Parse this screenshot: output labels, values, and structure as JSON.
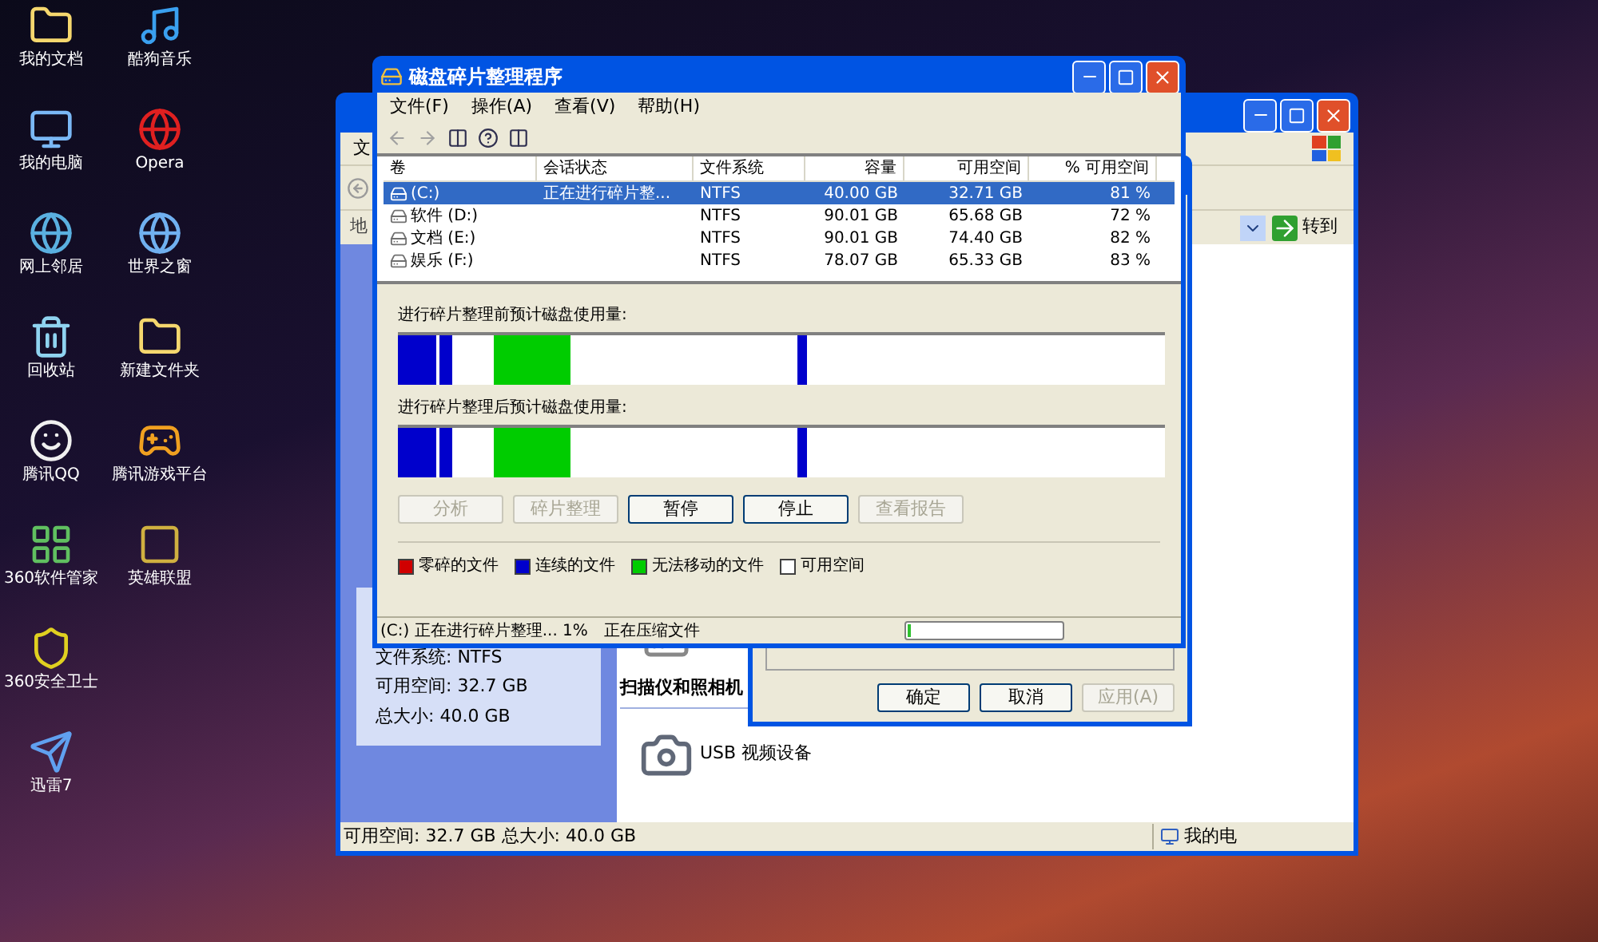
{
  "desktop": {
    "columns": [
      [
        "我的文档",
        "我的电脑",
        "网上邻居",
        "回收站",
        "腾讯QQ",
        "360软件管家",
        "360安全卫士",
        "迅雷7"
      ],
      [
        "酷狗音乐",
        "Opera",
        "世界之窗",
        "新建文件夹",
        "腾讯游戏平台",
        "英雄联盟"
      ]
    ]
  },
  "explorer_window": {
    "menu_fragment": "文",
    "address_label_fragment": "地",
    "go_button": "转到",
    "details": [
      "文件系统: NTFS",
      "可用空间: 32.7 GB",
      "总大小: 40.0 GB"
    ],
    "section_title": "扫描仪和照相机",
    "device": "USB 视频设备",
    "status_bar": {
      "text": "可用空间: 32.7 GB  总大小: 40.0 GB",
      "zone": "我的电"
    }
  },
  "properties_dialog": {
    "buttons": [
      {
        "label": "确定",
        "disabled": false
      },
      {
        "label": "取消",
        "disabled": false
      },
      {
        "label": "应用(A)",
        "disabled": true
      }
    ]
  },
  "defrag_window": {
    "title": "磁盘碎片整理程序",
    "menu": [
      "文件(F)",
      "操作(A)",
      "查看(V)",
      "帮助(H)"
    ],
    "table": {
      "columns": [
        "卷",
        "会话状态",
        "文件系统",
        "容量",
        "可用空间",
        "% 可用空间"
      ],
      "rows": [
        {
          "cells": [
            "(C:)",
            "正在进行碎片整...",
            "NTFS",
            "40.00 GB",
            "32.71 GB",
            "81 %"
          ],
          "selected": true
        },
        {
          "cells": [
            "软件 (D:)",
            "",
            "NTFS",
            "90.01 GB",
            "65.68 GB",
            "72 %"
          ],
          "selected": false
        },
        {
          "cells": [
            "文档 (E:)",
            "",
            "NTFS",
            "90.01 GB",
            "74.40 GB",
            "82 %"
          ],
          "selected": false
        },
        {
          "cells": [
            "娱乐 (F:)",
            "",
            "NTFS",
            "78.07 GB",
            "65.33 GB",
            "83 %"
          ],
          "selected": false
        }
      ]
    },
    "before_label": "进行碎片整理前预计磁盘使用量:",
    "after_label": "进行碎片整理后预计磁盘使用量:",
    "buttons": [
      {
        "label": "分析",
        "disabled": true
      },
      {
        "label": "碎片整理",
        "disabled": true
      },
      {
        "label": "暂停",
        "disabled": false
      },
      {
        "label": "停止",
        "disabled": false
      },
      {
        "label": "查看报告",
        "disabled": true
      }
    ],
    "legend": [
      {
        "label": "零碎的文件",
        "color": "#d00000"
      },
      {
        "label": "连续的文件",
        "color": "#0000cc"
      },
      {
        "label": "无法移动的文件",
        "color": "#00cc00"
      },
      {
        "label": "可用空间",
        "color": "#ffffff"
      }
    ],
    "status_bar": {
      "text": "(C:) 正在进行碎片整理... 1%",
      "action": "正在压缩文件",
      "progress": {
        "level": 0.02
      }
    }
  }
}
